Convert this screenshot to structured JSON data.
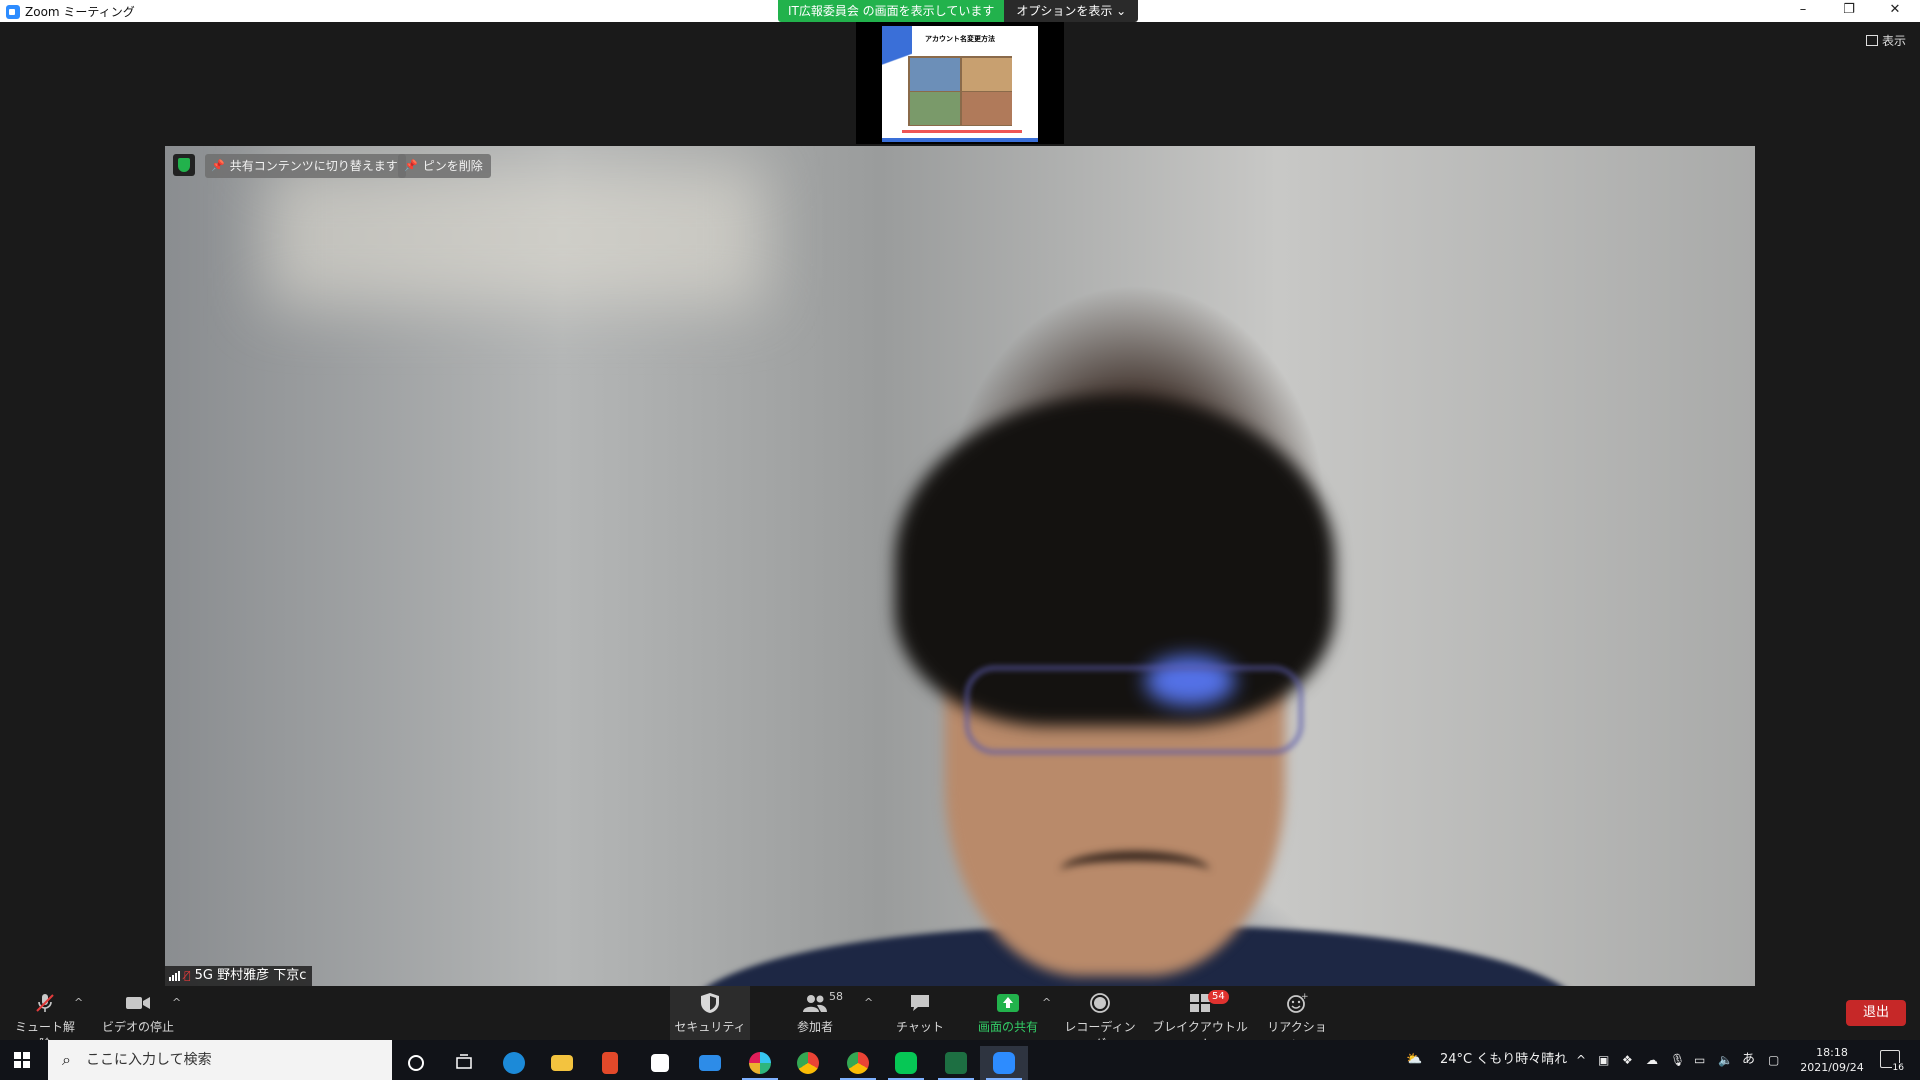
{
  "window": {
    "title": "Zoom ミーティング"
  },
  "share_banner": {
    "text": "IT広報委員会 の画面を表示しています",
    "options": "オプションを表示"
  },
  "view_button": {
    "label": "表示"
  },
  "thumbnail": {
    "slide_title": "アカウント名変更方法"
  },
  "video": {
    "switch_label": "共有コンテンツに切り替えます",
    "unpin_label": "ピンを削除",
    "participant_name": "5G 野村雅彦 下京c"
  },
  "toolbar": {
    "mute": "ミュート解除",
    "video": "ビデオの停止",
    "security": "セキュリティ",
    "participants": "参加者",
    "participant_count": "58",
    "chat": "チャット",
    "share": "画面の共有",
    "record": "レコーディング",
    "breakout": "ブレイクアウトルーム",
    "breakout_badge": "54",
    "reactions": "リアクション",
    "leave": "退出"
  },
  "taskbar": {
    "search_placeholder": "ここに入力して検索",
    "weather": "24°C くもり時々晴れ",
    "ime": "あ",
    "time": "18:18",
    "date": "2021/09/24",
    "notification_count": "16"
  },
  "colors": {
    "zoom_blue": "#2d8cff",
    "share_green": "#22b24c",
    "leave_red": "#c62828"
  }
}
